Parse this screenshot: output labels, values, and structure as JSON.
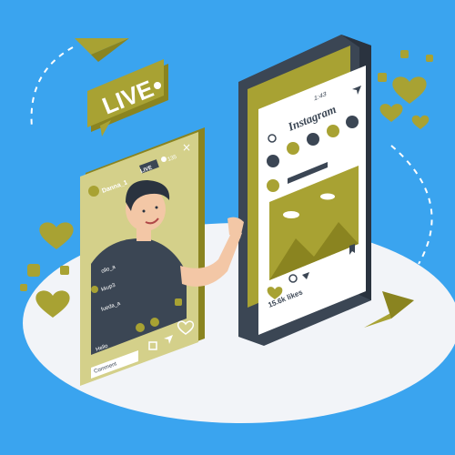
{
  "live_badge": {
    "label": "LIVE"
  },
  "live_stream": {
    "username": "Danna_1",
    "live_tag": "LIVE",
    "viewer_count": "135",
    "close_symbol": "×",
    "comments": [
      {
        "user": "ollo_a"
      },
      {
        "user": "kkup3"
      },
      {
        "user": "fueda_a"
      }
    ],
    "hello_text": "Hello",
    "comment_placeholder": "Comment"
  },
  "phone": {
    "time": "1:43",
    "app_name": "Instagram",
    "likes_text": "15.6k likes"
  },
  "colors": {
    "background": "#3aa4ef",
    "accent": "#a8a233",
    "accent_dark": "#8a8420",
    "phone_body": "#3b4654",
    "card_bg": "#d4d08a",
    "floor": "#f2f4f8"
  }
}
